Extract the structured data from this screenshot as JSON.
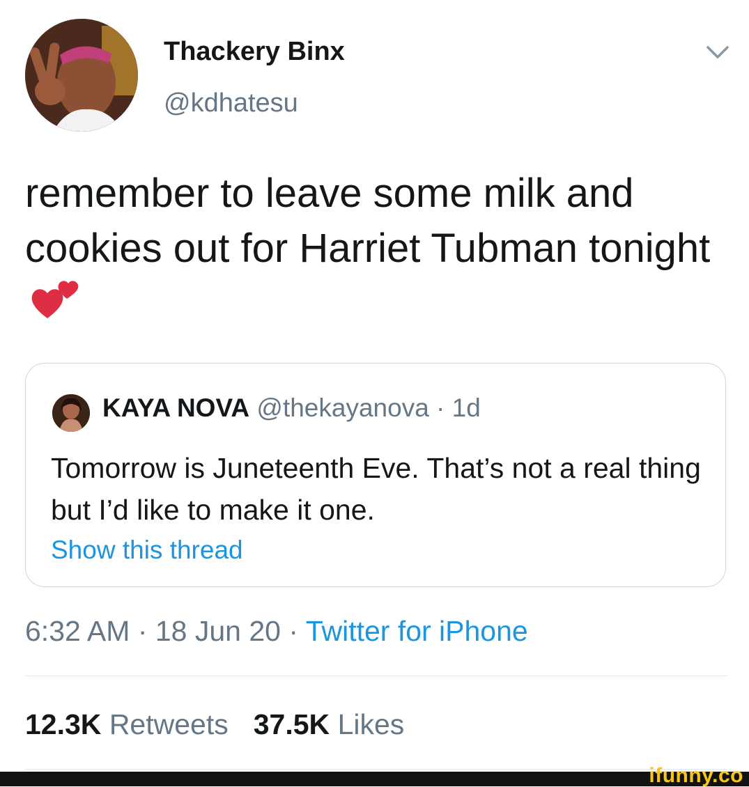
{
  "tweet": {
    "author": {
      "display_name": "Thackery Binx",
      "handle": "@kdhatesu"
    },
    "text": "remember to leave some milk and cookies out for Harriet Tubman tonight",
    "emoji": "two-hearts-emoji",
    "quoted_tweet": {
      "author_name": "KAYA NOVA",
      "author_handle": "@thekayanova",
      "separator": " · ",
      "age": "1d",
      "text": "Tomorrow is Juneteenth Eve. That’s not a real thing but I’d like to make it one.",
      "show_thread_label": "Show this thread"
    },
    "time": "6:32 AM",
    "date": "18 Jun 20",
    "meta_separator": " · ",
    "source": "Twitter for iPhone",
    "stats": {
      "retweets_count": "12.3K",
      "retweets_label": "Retweets",
      "likes_count": "37.5K",
      "likes_label": "Likes"
    }
  },
  "watermark": {
    "text": "ifunny.co",
    "color": "#f5c518"
  },
  "colors": {
    "text_primary": "#14171a",
    "text_secondary": "#657786",
    "link": "#1b95e0",
    "border": "#ccd6dd",
    "divider": "#e1e8ed"
  }
}
